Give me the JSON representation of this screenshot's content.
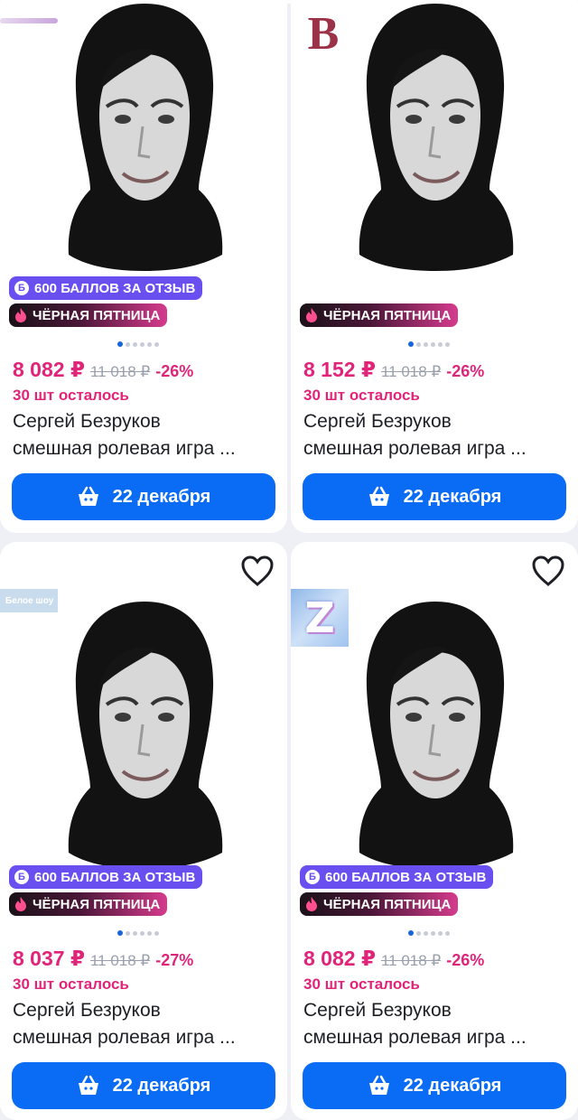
{
  "colors": {
    "accent_blue": "#0a6cf5",
    "price_pink": "#e0247a",
    "points_purple": "#6a4ff0",
    "background": "#eef0f5"
  },
  "cards": [
    {
      "points_badge": "600 БАЛЛОВ ЗА ОТЗЫВ",
      "points_coin": "Б",
      "promo_badge": "ЧЁРНАЯ ПЯТНИЦА",
      "price": "8 082 ₽",
      "old_price": "11 018 ₽",
      "discount": "-26%",
      "stock": "30 шт осталось",
      "title_line1": "Сергей Безруков",
      "title_line2": "смешная ролевая игра ...",
      "delivery": "22 декабря",
      "brand_logo": "",
      "favorite": false
    },
    {
      "points_badge": "",
      "points_coin": "",
      "promo_badge": "ЧЁРНАЯ ПЯТНИЦА",
      "price": "8 152 ₽",
      "old_price": "11 018 ₽",
      "discount": "-26%",
      "stock": "30 шт осталось",
      "title_line1": "Сергей Безруков",
      "title_line2": "смешная ролевая игра ...",
      "delivery": "22 декабря",
      "brand_logo": "B",
      "favorite": false
    },
    {
      "points_badge": "600 БАЛЛОВ ЗА ОТЗЫВ",
      "points_coin": "Б",
      "promo_badge": "ЧЁРНАЯ ПЯТНИЦА",
      "price": "8 037 ₽",
      "old_price": "11 018 ₽",
      "discount": "-27%",
      "stock": "30 шт осталось",
      "title_line1": "Сергей Безруков",
      "title_line2": "смешная ролевая игра ...",
      "delivery": "22 декабря",
      "brand_logo": "Белое шоу",
      "favorite": true
    },
    {
      "points_badge": "600 БАЛЛОВ ЗА ОТЗЫВ",
      "points_coin": "Б",
      "promo_badge": "ЧЁРНАЯ ПЯТНИЦА",
      "price": "8 082 ₽",
      "old_price": "11 018 ₽",
      "discount": "-26%",
      "stock": "30 шт осталось",
      "title_line1": "Сергей Безруков",
      "title_line2": "смешная ролевая игра ...",
      "delivery": "22 декабря",
      "brand_logo": "Z",
      "favorite": true
    }
  ]
}
